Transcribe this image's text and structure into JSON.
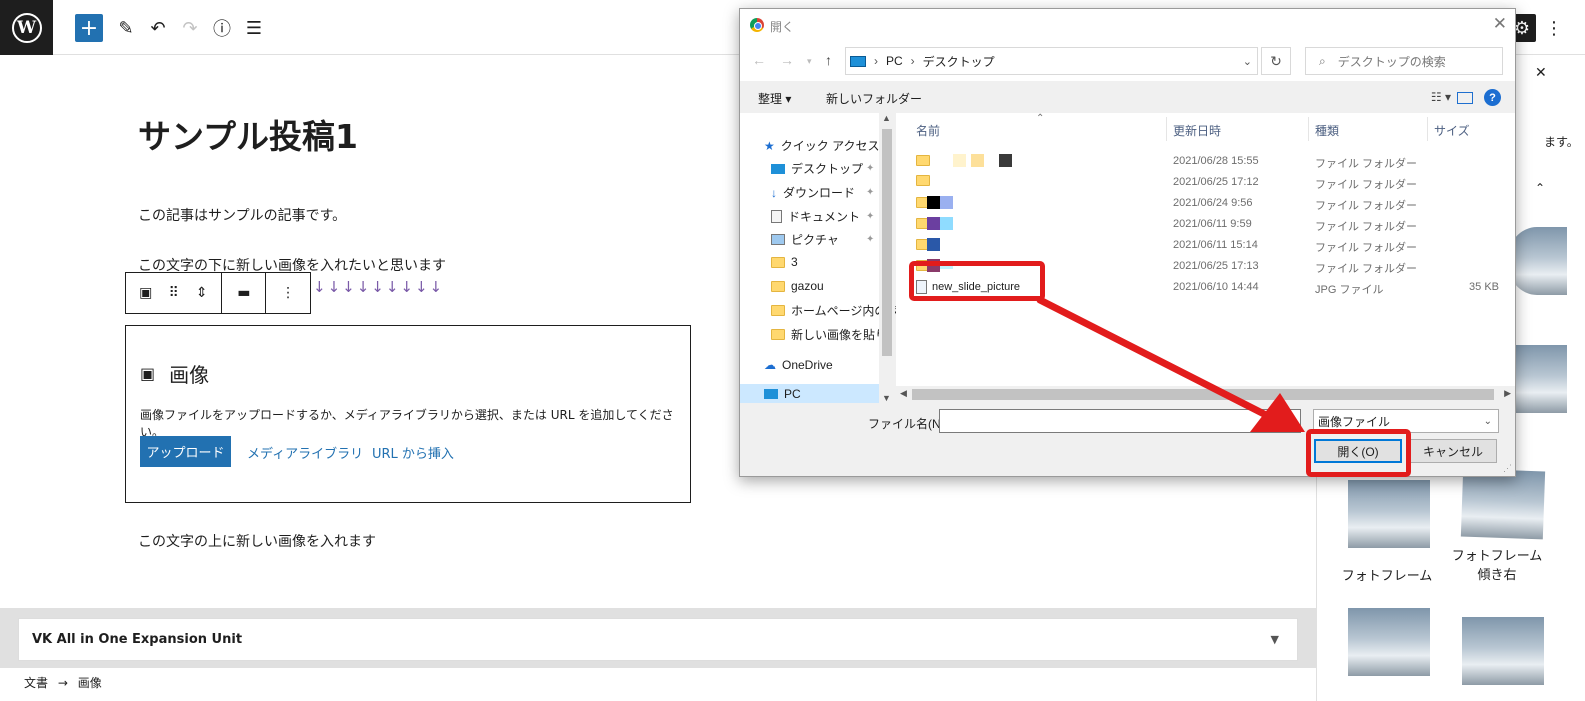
{
  "toolbar": {
    "logo_letter": "W",
    "add_label": "+",
    "pencil_icon": "✎",
    "undo_icon": "↶",
    "redo_icon": "↷",
    "info_icon": "ⓘ",
    "list_icon": "☰"
  },
  "editor": {
    "title": "サンプル投稿1",
    "para1": "この記事はサンプルの記事です。",
    "para2": "この文字の下に新しい画像を入れたいと思います",
    "arrows": "↓↓↓↓↓↓↓↓↓",
    "para3": "この文字の上に新しい画像を入れます",
    "image_block": {
      "label": "画像",
      "description": "画像ファイルをアップロードするか、メディアライブラリから選択、または URL を追加してください。",
      "upload": "アップロード",
      "media_library": "メディアライブラリ",
      "url_insert": "URL から挿入"
    }
  },
  "metabox": {
    "title": "VK All in One Expansion Unit"
  },
  "breadcrumb": {
    "doc": "文書",
    "arrow": "→",
    "block": "画像"
  },
  "sidebar": {
    "partial_text": "ます。",
    "captions": [
      "フォトフレーム",
      "フォトフレーム傾き右"
    ]
  },
  "dialog": {
    "title": "開く",
    "path": [
      "PC",
      "デスクトップ"
    ],
    "search_placeholder": "デスクトップの検索",
    "organize": "整理",
    "new_folder": "新しいフォルダー",
    "nav": [
      {
        "label": "クイック アクセス",
        "icon": "star-icon"
      },
      {
        "label": "デスクトップ",
        "icon": "desktop-icon",
        "pinned": true
      },
      {
        "label": "ダウンロード",
        "icon": "download-icon",
        "pinned": true
      },
      {
        "label": "ドキュメント",
        "icon": "document-icon",
        "pinned": true
      },
      {
        "label": "ピクチャ",
        "icon": "picture-icon",
        "pinned": true
      },
      {
        "label": "3",
        "icon": "folder-icon"
      },
      {
        "label": "gazou",
        "icon": "folder-icon"
      },
      {
        "label": "ホームページ内のペ",
        "icon": "folder-icon"
      },
      {
        "label": "新しい画像を貼り",
        "icon": "folder-icon"
      },
      {
        "label": "OneDrive",
        "icon": "cloud-icon"
      },
      {
        "label": "PC",
        "icon": "pc-icon"
      }
    ],
    "columns": [
      "名前",
      "更新日時",
      "種類",
      "サイズ"
    ],
    "files": [
      {
        "name": "",
        "date": "2021/06/28 15:55",
        "type": "ファイル フォルダー",
        "size": ""
      },
      {
        "name": "",
        "date": "2021/06/25 17:12",
        "type": "ファイル フォルダー",
        "size": ""
      },
      {
        "name": "",
        "date": "2021/06/24 9:56",
        "type": "ファイル フォルダー",
        "size": ""
      },
      {
        "name": "",
        "date": "2021/06/11 9:59",
        "type": "ファイル フォルダー",
        "size": ""
      },
      {
        "name": "",
        "date": "2021/06/11 15:14",
        "type": "ファイル フォルダー",
        "size": ""
      },
      {
        "name": "",
        "date": "2021/06/25 17:13",
        "type": "ファイル フォルダー",
        "size": ""
      },
      {
        "name": "new_slide_picture",
        "date": "2021/06/10 14:44",
        "type": "JPG ファイル",
        "size": "35 KB"
      }
    ],
    "filename_label": "ファイル名(N):",
    "filename_value": "",
    "filetype": "画像ファイル",
    "open": "開く(O)",
    "cancel": "キャンセル",
    "annotation_color": "#e21c1c"
  }
}
